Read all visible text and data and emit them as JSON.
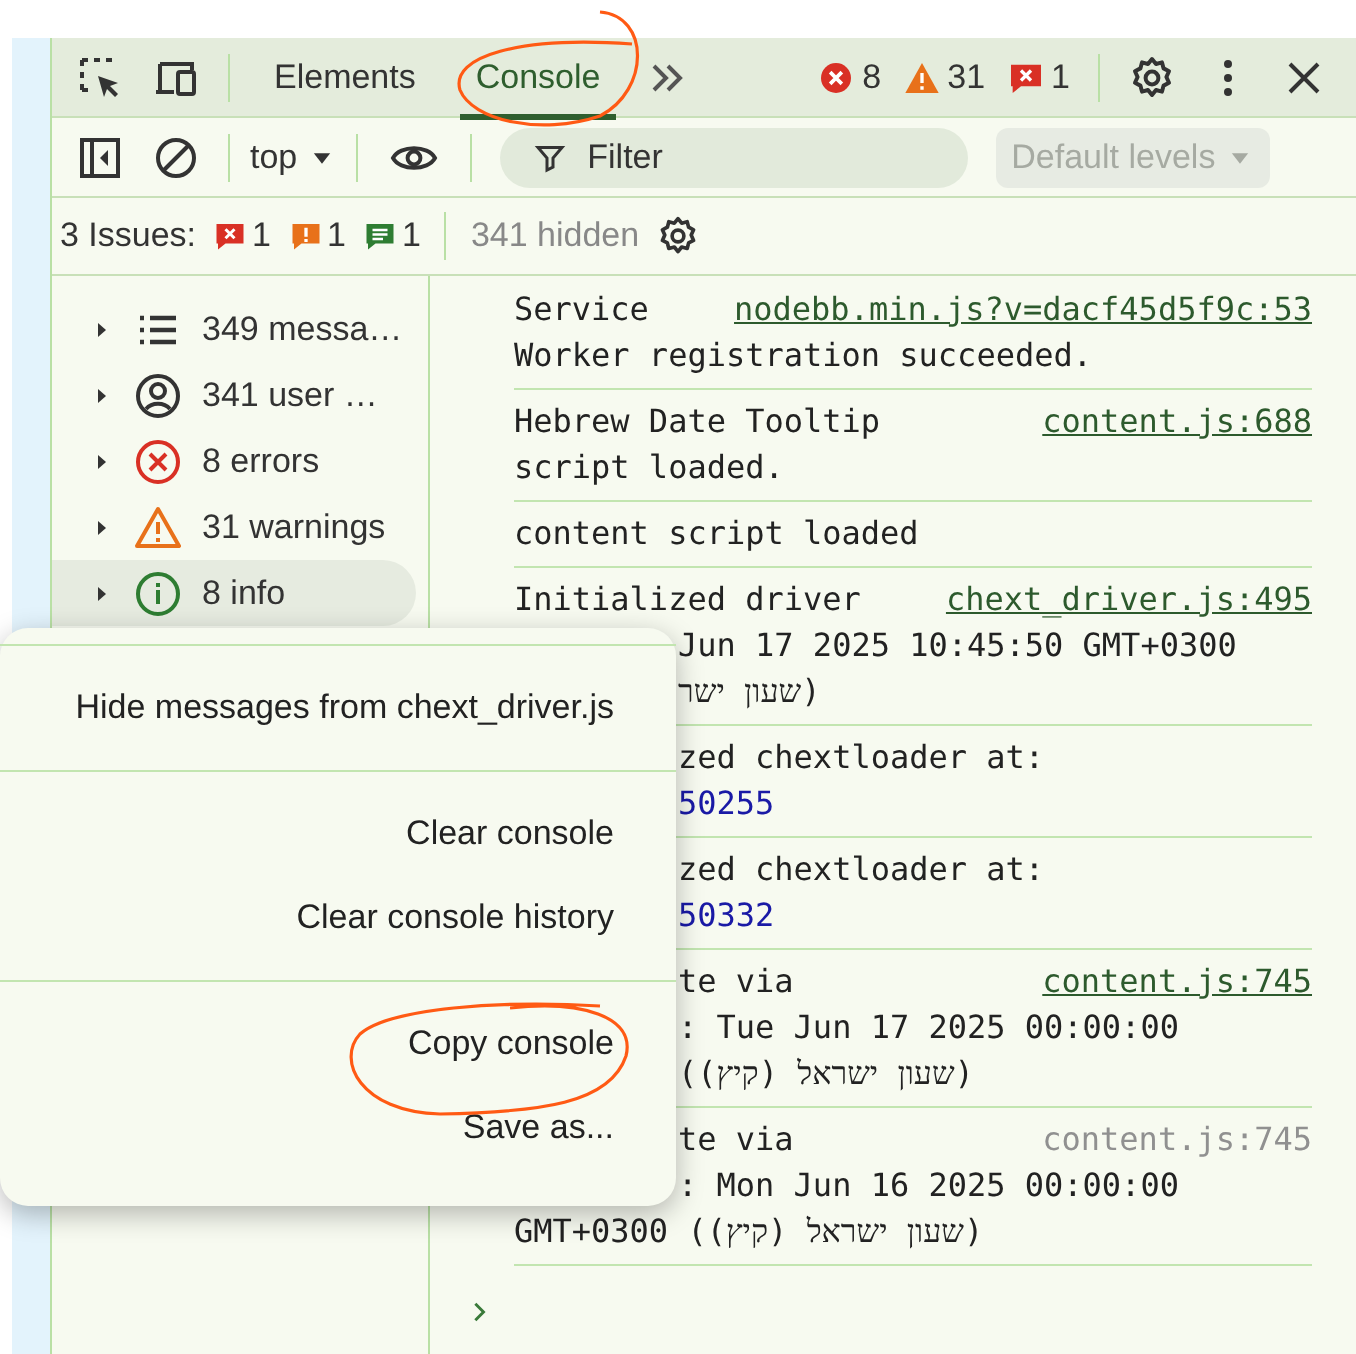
{
  "toolbar": {
    "tabs": [
      {
        "label": "Elements",
        "selected": false
      },
      {
        "label": "Console",
        "selected": true
      }
    ],
    "counters": [
      {
        "kind": "error",
        "count": "8"
      },
      {
        "kind": "warning",
        "count": "31"
      },
      {
        "kind": "issue",
        "count": "1"
      }
    ]
  },
  "console_toolbar": {
    "context": "top",
    "filter": {
      "placeholder": "Filter"
    },
    "levels": {
      "label": "Default levels",
      "disabled": true
    }
  },
  "issues_bar": {
    "label": "3 Issues:",
    "counts": [
      {
        "kind": "error",
        "count": "1"
      },
      {
        "kind": "warning",
        "count": "1"
      },
      {
        "kind": "info",
        "count": "1"
      }
    ],
    "hidden": "341 hidden"
  },
  "sidebar": {
    "items": [
      {
        "kind": "messages",
        "label": "349 messa…",
        "selected": false
      },
      {
        "kind": "user",
        "label": "341 user …",
        "selected": false
      },
      {
        "kind": "error",
        "label": "8 errors",
        "selected": false
      },
      {
        "kind": "warning",
        "label": "31 warnings",
        "selected": false
      },
      {
        "kind": "info",
        "label": "8 info",
        "selected": true
      }
    ]
  },
  "messages": [
    {
      "source": "nodebb.min.js?v=dacf45d5f9c:53",
      "source_muted": false,
      "lines": [
        {
          "kind": "text",
          "text": "Service",
          "covered": false
        },
        {
          "kind": "text",
          "text": "Worker registration succeeded.",
          "covered": false
        }
      ]
    },
    {
      "source": "content.js:688",
      "source_muted": false,
      "lines": [
        {
          "kind": "text",
          "text": "Hebrew Date Tooltip",
          "covered": false
        },
        {
          "kind": "text",
          "text": "script loaded.",
          "covered": false
        }
      ]
    },
    {
      "lines": [
        {
          "kind": "text",
          "text": "content script loaded",
          "covered": false
        }
      ]
    },
    {
      "source": "chext_driver.js:495",
      "source_muted": false,
      "lines": [
        {
          "kind": "text",
          "text": "Initialized driver",
          "covered": false
        },
        {
          "kind": "text",
          "text": "Jun 17 2025 10:45:50 GMT+0300",
          "covered": true
        },
        {
          "kind": "text",
          "text": "שעון ישר)",
          "covered": true
        }
      ]
    },
    {
      "lines": [
        {
          "kind": "text",
          "text": "zed chextloader at:",
          "covered": true
        },
        {
          "kind": "number",
          "text": "50255",
          "covered": true
        }
      ]
    },
    {
      "lines": [
        {
          "kind": "text",
          "text": "zed chextloader at:",
          "covered": true
        },
        {
          "kind": "number",
          "text": "50332",
          "covered": true
        }
      ]
    },
    {
      "source": "content.js:745",
      "source_muted": false,
      "lines": [
        {
          "kind": "text",
          "text": "te via",
          "covered": true
        },
        {
          "kind": "text",
          "text": ": Tue Jun 17 2025 00:00:00",
          "covered": true
        },
        {
          "kind": "text",
          "text": "(שעון ישראל (קיץ))",
          "covered": true
        }
      ]
    },
    {
      "source": "content.js:745",
      "source_muted": true,
      "lines": [
        {
          "kind": "text",
          "text": "te via",
          "covered": true
        },
        {
          "kind": "text",
          "text": ": Mon Jun 16 2025 00:00:00",
          "covered": true
        },
        {
          "kind": "text",
          "text": "GMT+0300 (שעון ישראל (קיץ))",
          "covered": false
        }
      ]
    }
  ],
  "context_menu": {
    "groups": [
      {
        "items": [
          {
            "label": "Hide messages from chext_driver.js"
          }
        ]
      },
      {
        "items": [
          {
            "label": "Clear console"
          },
          {
            "label": "Clear console history"
          }
        ]
      },
      {
        "items": [
          {
            "label": "Copy console"
          },
          {
            "label": "Save as..."
          }
        ]
      }
    ]
  }
}
